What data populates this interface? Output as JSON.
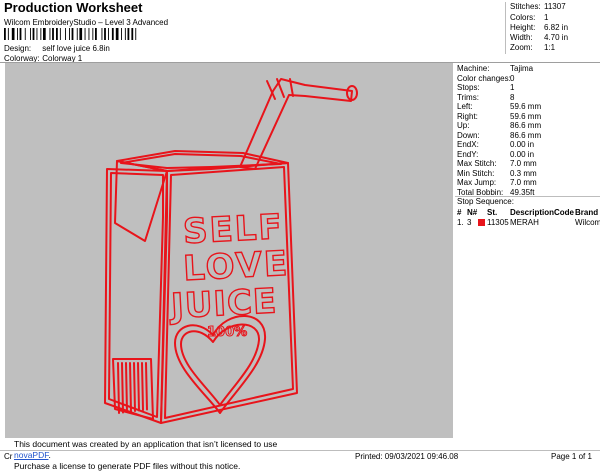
{
  "header": {
    "title": "Production Worksheet",
    "subtitle": "Wilcom EmbroideryStudio – Level 3 Advanced"
  },
  "design": {
    "label": "Design:",
    "value": "self love juice 6.8in"
  },
  "colorway": {
    "label": "Colorway:",
    "value": "Colorway 1"
  },
  "stats": [
    {
      "label": "Stitches:",
      "value": "11307"
    },
    {
      "label": "Colors:",
      "value": "1"
    },
    {
      "label": "Height:",
      "value": "6.82 in"
    },
    {
      "label": "Width:",
      "value": "4.70 in"
    },
    {
      "label": "Zoom:",
      "value": "1:1"
    }
  ],
  "machine_info": [
    {
      "label": "Machine:",
      "value": "Tajima"
    },
    {
      "label": "Color changes:",
      "value": "0"
    },
    {
      "label": "Stops:",
      "value": "1"
    },
    {
      "label": "Trims:",
      "value": "8"
    },
    {
      "label": "Left:",
      "value": "59.6 mm"
    },
    {
      "label": "Right:",
      "value": "59.6 mm"
    },
    {
      "label": "Up:",
      "value": "86.6 mm"
    },
    {
      "label": "Down:",
      "value": "86.6 mm"
    },
    {
      "label": "EndX:",
      "value": "0.00 in"
    },
    {
      "label": "EndY:",
      "value": "0.00 in"
    },
    {
      "label": "Max Stitch:",
      "value": "7.0 mm"
    },
    {
      "label": "Min Stitch:",
      "value": "0.3 mm"
    },
    {
      "label": "Max Jump:",
      "value": "7.0 mm"
    },
    {
      "label": "Total Bobbin:",
      "value": "49.35ft"
    }
  ],
  "stop_sequence": {
    "title": "Stop Sequence:",
    "columns": {
      "num": "#",
      "n": "N#",
      "stitches": "St.",
      "description": "Description",
      "code": "Code",
      "brand": "Brand"
    },
    "rows": [
      {
        "num": "1.",
        "n": "3",
        "stitches": "11305",
        "description": "MERAH",
        "code": "",
        "brand": "Wilcom",
        "color": "#e8141b"
      }
    ]
  },
  "artwork": {
    "stroke_color": "#e8141b",
    "text_lines": [
      "SELF",
      "LOVE",
      "JUICE"
    ],
    "percent_text": "100%"
  },
  "notice": {
    "line1_before": "This document was created by an application that isn’t licensed to use ",
    "link": "novaPDF",
    "line1_after": ".",
    "line2": "Purchase a license to generate PDF files without this notice."
  },
  "footer": {
    "left": "Cr",
    "printed": "Printed: 09/03/2021 09:46.08",
    "page": "Page 1 of 1"
  }
}
